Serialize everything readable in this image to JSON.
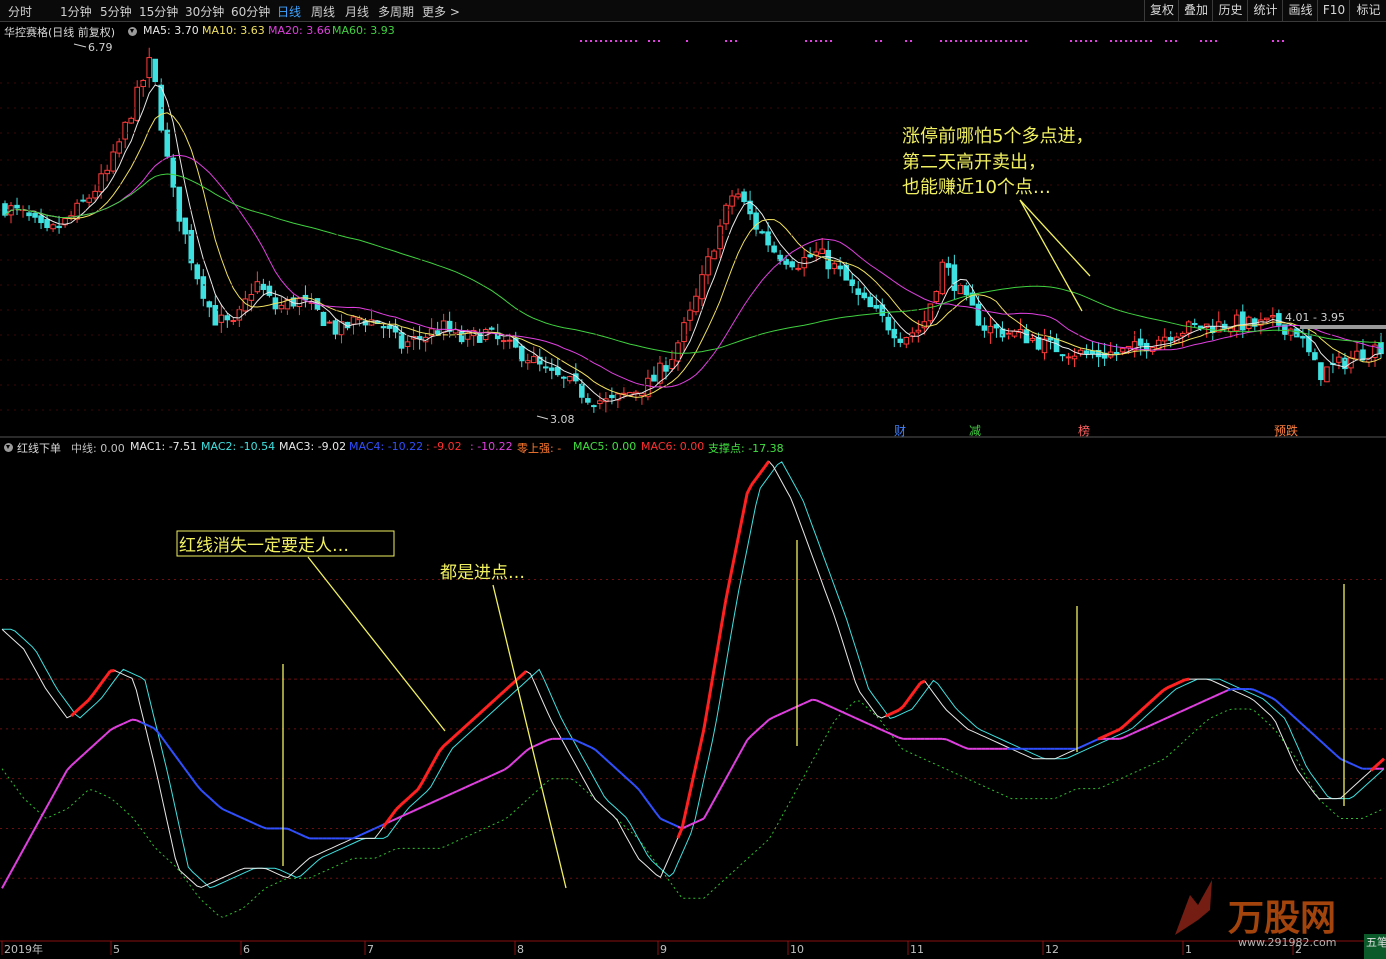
{
  "toolbar": {
    "periods": [
      "分时",
      "1分钟",
      "5分钟",
      "15分钟",
      "30分钟",
      "60分钟",
      "日线",
      "周线",
      "月线",
      "多周期",
      "更多 >"
    ],
    "active_period": "日线",
    "tools": [
      "复权",
      "叠加",
      "历史",
      "统计",
      "画线",
      "F10",
      "标记"
    ]
  },
  "upper_legend": {
    "name": "华控赛格(日线 前复权)",
    "items": [
      {
        "label": "MA5: 3.70",
        "color": "#e8e8e8"
      },
      {
        "label": "MA10: 3.63",
        "color": "#f0e060"
      },
      {
        "label": "MA20: 3.66",
        "color": "#e040e0"
      },
      {
        "label": "MA60: 3.93",
        "color": "#40d040"
      }
    ]
  },
  "lower_legend": {
    "name": "红线下单",
    "items": [
      {
        "label": "中线: 0.00",
        "color": "#c0c0c0"
      },
      {
        "label": "MAC1: -7.51",
        "color": "#e8e8e8"
      },
      {
        "label": "MAC2: -10.54",
        "color": "#40e0e0"
      },
      {
        "label": "MAC3: -9.02",
        "color": "#e8e8e8"
      },
      {
        "label": "MAC4: -10.22",
        "color": "#3050ff"
      },
      {
        "label": ": -9.02",
        "color": "#ff3030"
      },
      {
        "label": ": -10.22",
        "color": "#e040e0"
      },
      {
        "label": "零上强: -",
        "color": "#ff7a30"
      },
      {
        "label": "MAC5: 0.00",
        "color": "#40e040"
      },
      {
        "label": "MAC6: 0.00",
        "color": "#ff3030"
      },
      {
        "label": "支撑点: -17.38",
        "color": "#40e040"
      }
    ]
  },
  "annotations": {
    "upper_note_lines": [
      "涨停前哪怕5个多点进，",
      "第二天高开卖出，",
      "也能赚近10个点…"
    ],
    "box_note": "红线消失一定要走人…",
    "entry_note": "都是进点…"
  },
  "price_labels": {
    "high": "6.79",
    "low": "3.08",
    "range": "4.01 - 3.95"
  },
  "event_badges": [
    {
      "label": "财",
      "color": "#4080ff"
    },
    {
      "label": "减",
      "color": "#40d040"
    },
    {
      "label": "榜",
      "color": "#ff6060"
    },
    {
      "label": "预跌",
      "color": "#ff8040"
    }
  ],
  "watermark": {
    "brand": "万股网",
    "url": "www.291982.com"
  },
  "corner_label": "五笔",
  "chart_data": {
    "type": "candlestick",
    "title": "华控赛格(日线 前复权)",
    "price_ylim": [
      2.9,
      7.0
    ],
    "x_axis_labels": [
      "2019年",
      "5",
      "6",
      "7",
      "8",
      "9",
      "10",
      "11",
      "12",
      "1",
      "2"
    ],
    "price_path": [
      5.2,
      5.1,
      4.9,
      5.05,
      5.3,
      5.6,
      6.2,
      6.79,
      5.4,
      4.6,
      4.0,
      3.9,
      4.4,
      4.1,
      4.2,
      4.05,
      3.85,
      4.0,
      3.95,
      3.7,
      3.8,
      3.9,
      3.75,
      3.85,
      3.7,
      3.6,
      3.4,
      3.3,
      3.15,
      3.08,
      3.2,
      3.3,
      3.6,
      4.1,
      4.8,
      5.4,
      5.0,
      4.7,
      4.6,
      4.7,
      4.5,
      4.2,
      4.0,
      3.8,
      3.9,
      4.6,
      4.2,
      3.9,
      3.85,
      3.8,
      3.7,
      3.65,
      3.6,
      3.62,
      3.65,
      3.75,
      3.85,
      3.9,
      3.92,
      3.95,
      3.92,
      3.95,
      3.85,
      3.4,
      3.5,
      3.62,
      3.7
    ],
    "ma_values_latest": {
      "MA5": 3.7,
      "MA10": 3.63,
      "MA20": 3.66,
      "MA60": 3.93
    },
    "indicator_ylim": [
      -26,
      22
    ],
    "indicator_reference_lines": [
      10,
      0,
      -5,
      -10,
      -15,
      -20
    ],
    "indicator_values_latest": {
      "中线": 0.0,
      "MAC1": -7.51,
      "MAC2": -10.54,
      "MAC3": -9.02,
      "MAC4": -10.22,
      "MAC5": 0.0,
      "MAC6": 0.0,
      "支撑点": -17.38
    },
    "mac1_path": [
      5,
      3,
      -1,
      -4,
      -2,
      1,
      0,
      -9,
      -19,
      -21,
      -20,
      -19,
      -19,
      -20,
      -18,
      -17,
      -16,
      -16,
      -13,
      -11,
      -7,
      -5,
      -3,
      -1,
      1,
      -4,
      -8,
      -12,
      -14,
      -18,
      -20,
      -15,
      -5,
      8,
      19,
      22,
      18,
      12,
      6,
      -1,
      -4,
      -3,
      0,
      -3,
      -5,
      -6,
      -7,
      -8,
      -8,
      -7,
      -6,
      -5,
      -3,
      -1,
      0,
      0,
      -1,
      -2,
      -4,
      -9,
      -12,
      -12,
      -10,
      -8
    ],
    "mac4_path": [
      -21,
      -17,
      -13,
      -9,
      -7,
      -5,
      -4,
      -5,
      -8,
      -11,
      -13,
      -14,
      -15,
      -15,
      -16,
      -16,
      -16,
      -15,
      -14,
      -13,
      -12,
      -11,
      -10,
      -9,
      -7,
      -6,
      -6,
      -7,
      -9,
      -11,
      -14,
      -15,
      -14,
      -10,
      -6,
      -4,
      -3,
      -2,
      -3,
      -4,
      -5,
      -6,
      -6,
      -6,
      -7,
      -7,
      -7,
      -7,
      -7,
      -7,
      -6,
      -6,
      -5,
      -4,
      -3,
      -2,
      -1,
      -1,
      -2,
      -4,
      -6,
      -8,
      -9,
      -9
    ],
    "support_path": [
      -9,
      -12,
      -14,
      -13,
      -11,
      -12,
      -14,
      -17,
      -19,
      -22,
      -24,
      -23,
      -21,
      -20,
      -20,
      -19,
      -18,
      -18,
      -17,
      -17,
      -17,
      -16,
      -15,
      -14,
      -12,
      -10,
      -10,
      -12,
      -14,
      -16,
      -19,
      -22,
      -22,
      -20,
      -18,
      -16,
      -12,
      -8,
      -4,
      -2,
      -4,
      -7,
      -8,
      -9,
      -10,
      -11,
      -12,
      -12,
      -12,
      -11,
      -11,
      -10,
      -9,
      -8,
      -6,
      -4,
      -3,
      -3,
      -5,
      -8,
      -12,
      -14,
      -14,
      -13
    ]
  }
}
